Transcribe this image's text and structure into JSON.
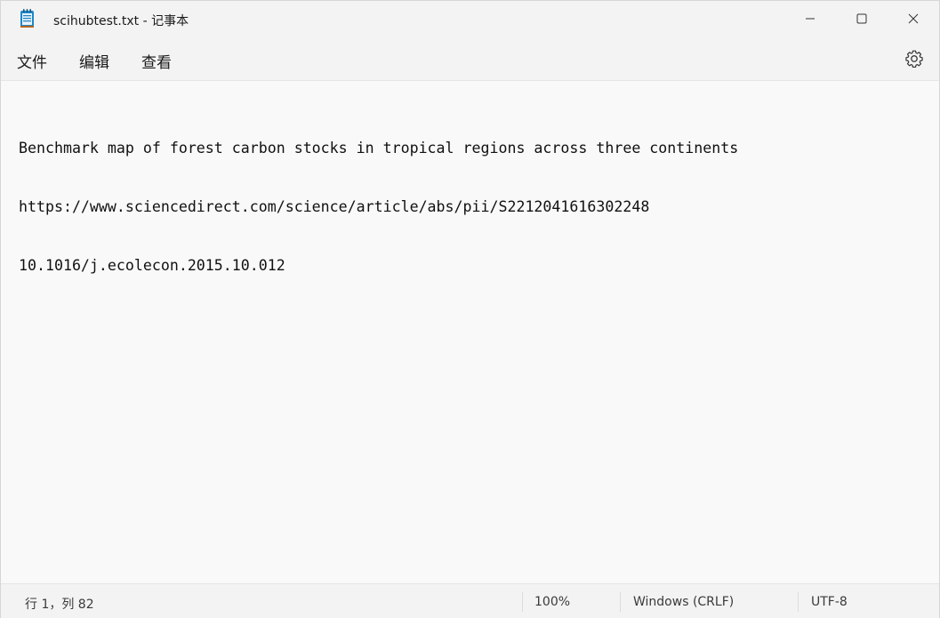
{
  "window": {
    "title": "scihubtest.txt - 记事本",
    "app_icon": "notepad-icon",
    "controls": {
      "minimize_icon": "minimize-icon",
      "maximize_icon": "maximize-icon",
      "close_icon": "close-icon"
    }
  },
  "menu": {
    "items": [
      {
        "label": "文件"
      },
      {
        "label": "编辑"
      },
      {
        "label": "查看"
      }
    ],
    "settings_icon": "gear-icon"
  },
  "editor": {
    "lines": [
      "Benchmark map of forest carbon stocks in tropical regions across three continents",
      "https://www.sciencedirect.com/science/article/abs/pii/S2212041616302248",
      "10.1016/j.ecolecon.2015.10.012"
    ]
  },
  "status": {
    "position": "行 1，列 82",
    "zoom": "100%",
    "line_ending": "Windows (CRLF)",
    "encoding": "UTF-8"
  },
  "colors": {
    "chrome": "#f3f3f3",
    "editor_bg": "#f9f9f9",
    "icon_blue": "#1e88c8"
  }
}
